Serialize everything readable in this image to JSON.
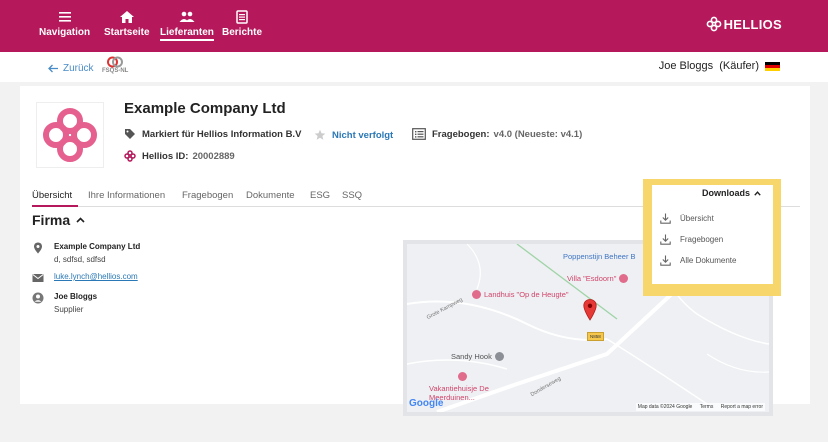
{
  "topnav": {
    "items": [
      {
        "label": "Navigation",
        "icon": "menu-icon"
      },
      {
        "label": "Startseite",
        "icon": "home-icon"
      },
      {
        "label": "Lieferanten",
        "icon": "users-icon",
        "active": true
      },
      {
        "label": "Berichte",
        "icon": "reports-icon"
      }
    ],
    "brand": "HELLIOS",
    "brand_color": "#b5195b"
  },
  "subbar": {
    "back_label": "Zurück",
    "badge_label": "FSQS-NL",
    "user_label": "Joe Bloggs  (Käufer)",
    "flag_icon": "germany-flag-icon"
  },
  "company": {
    "name": "Example Company Ltd",
    "tag_label": "Markiert für Hellios Information B.V",
    "follow_label": "Nicht verfolgt",
    "questionnaire_label": "Fragebogen:",
    "questionnaire_value": "v4.0 (Neueste: v4.1)",
    "hellios_id_label": "Hellios ID:",
    "hellios_id_value": "20002889"
  },
  "tabs": [
    {
      "label": "Übersicht",
      "active": true
    },
    {
      "label": "Ihre Informationen"
    },
    {
      "label": "Fragebogen"
    },
    {
      "label": "Dokumente"
    },
    {
      "label": "ESG"
    },
    {
      "label": "SSQ"
    }
  ],
  "section": {
    "title": "Firma",
    "address_name": "Example Company Ltd",
    "address_line": "d, sdfsd, sdfsd",
    "email": "luke.lynch@hellios.com",
    "contact_name": "Joe Bloggs",
    "contact_role": "Supplier"
  },
  "map": {
    "places": {
      "poppenstijn": "Poppenstijn Beheer B",
      "villa": "Villa \"Esdoorn\"",
      "landhuis": "Landhuis \"Op de Heugte\"",
      "sandy": "Sandy Hook",
      "vakantie": "Vakantiehuisje De",
      "vakantie2": "Meerduinen..."
    },
    "roads": {
      "kamp": "Grote Kampweg",
      "donder": "Donderseweg",
      "hwy": "N858"
    },
    "google": "Google",
    "attribution": [
      "Map data ©2024 Google",
      "Terms",
      "Report a map error"
    ]
  },
  "downloads": {
    "header": "Downloads",
    "items": [
      {
        "label": "Übersicht"
      },
      {
        "label": "Fragebogen"
      },
      {
        "label": "Alle Dokumente"
      }
    ],
    "highlight_color": "#f7d66b"
  }
}
